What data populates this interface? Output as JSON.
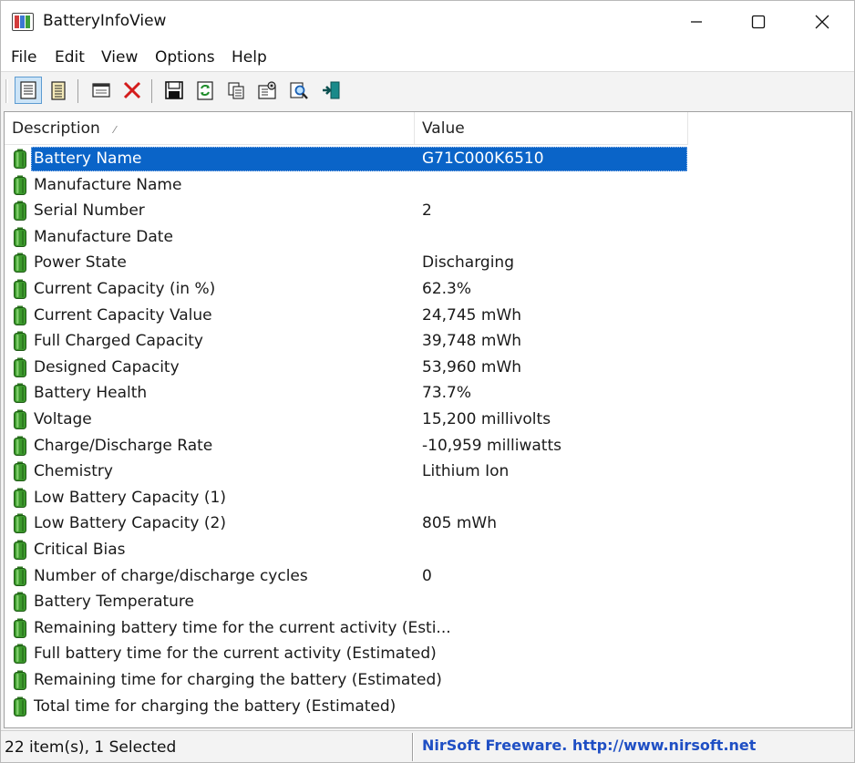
{
  "window": {
    "title": "BatteryInfoView"
  },
  "menu": [
    "File",
    "Edit",
    "View",
    "Options",
    "Help"
  ],
  "toolbar": {
    "icons": [
      "properties-icon",
      "html-report-icon",
      "show-window-icon",
      "delete-icon",
      "save-icon",
      "refresh-icon",
      "copy-icon",
      "options-icon",
      "find-icon",
      "exit-icon"
    ]
  },
  "columns": {
    "description": "Description",
    "value": "Value"
  },
  "rows": [
    {
      "description": "Battery Name",
      "value": "G71C000K6510",
      "selected": true
    },
    {
      "description": "Manufacture Name",
      "value": ""
    },
    {
      "description": "Serial Number",
      "value": "2"
    },
    {
      "description": "Manufacture Date",
      "value": ""
    },
    {
      "description": "Power State",
      "value": "Discharging"
    },
    {
      "description": "Current Capacity (in %)",
      "value": "62.3%"
    },
    {
      "description": "Current Capacity Value",
      "value": "24,745 mWh"
    },
    {
      "description": "Full Charged Capacity",
      "value": "39,748 mWh"
    },
    {
      "description": "Designed Capacity",
      "value": "53,960 mWh"
    },
    {
      "description": "Battery Health",
      "value": "73.7%"
    },
    {
      "description": "Voltage",
      "value": "15,200 millivolts"
    },
    {
      "description": "Charge/Discharge Rate",
      "value": "-10,959 milliwatts"
    },
    {
      "description": "Chemistry",
      "value": "Lithium Ion"
    },
    {
      "description": "Low Battery Capacity (1)",
      "value": ""
    },
    {
      "description": "Low Battery Capacity (2)",
      "value": "805 mWh"
    },
    {
      "description": "Critical Bias",
      "value": ""
    },
    {
      "description": "Number of charge/discharge cycles",
      "value": "0"
    },
    {
      "description": "Battery Temperature",
      "value": ""
    },
    {
      "description": "Remaining battery time for the current activity (Esti...",
      "value": ""
    },
    {
      "description": "Full battery time for the current activity (Estimated)",
      "value": ""
    },
    {
      "description": "Remaining time for charging the battery (Estimated)",
      "value": ""
    },
    {
      "description": "Total  time for charging the battery (Estimated)",
      "value": ""
    }
  ],
  "status": {
    "count": "22 item(s), 1 Selected",
    "credit": "NirSoft Freeware.  http://www.nirsoft.net"
  },
  "colors": {
    "selection": "#0a64c8",
    "battery": "#3c9a2c",
    "credit": "#1f4fc4"
  }
}
